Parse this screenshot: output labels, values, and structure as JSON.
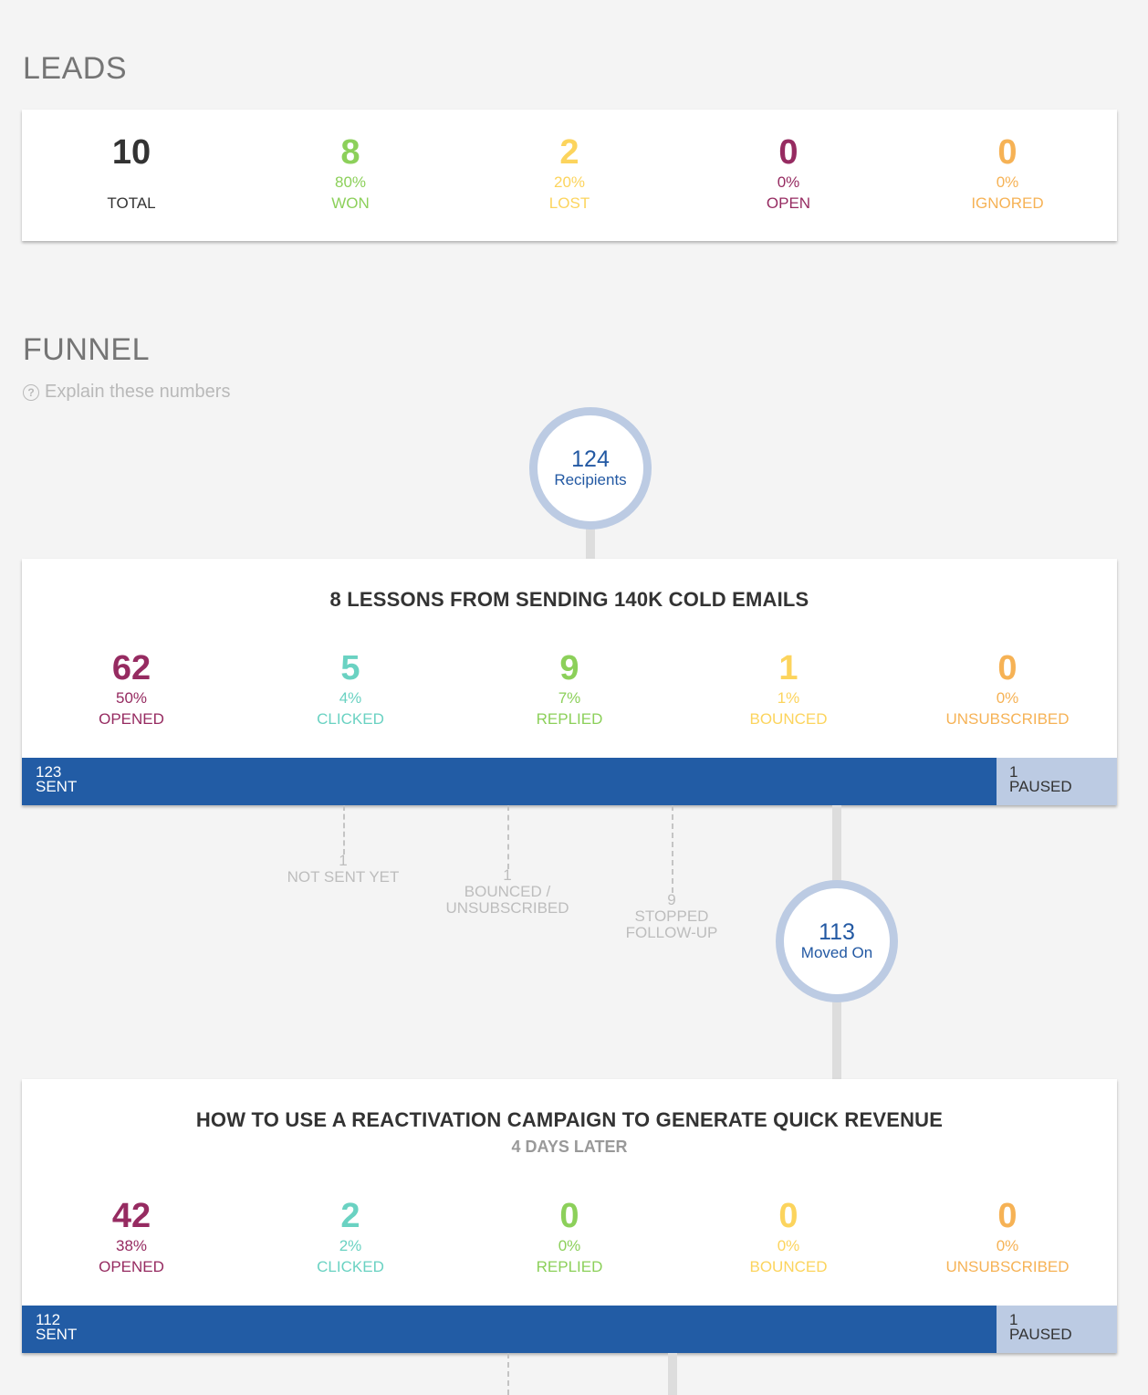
{
  "leads": {
    "title": "LEADS",
    "stats": [
      {
        "value": "10",
        "pct": "",
        "label": "TOTAL"
      },
      {
        "value": "8",
        "pct": "80%",
        "label": "WON"
      },
      {
        "value": "2",
        "pct": "20%",
        "label": "LOST"
      },
      {
        "value": "0",
        "pct": "0%",
        "label": "OPEN"
      },
      {
        "value": "0",
        "pct": "0%",
        "label": "IGNORED"
      }
    ]
  },
  "funnel": {
    "title": "FUNNEL",
    "explain_label": "Explain these numbers",
    "explain_icon": "?",
    "recipients": {
      "value": "124",
      "label": "Recipients"
    },
    "steps": [
      {
        "title": "8 LESSONS FROM SENDING 140K COLD EMAILS",
        "subtitle": "",
        "stats": [
          {
            "value": "62",
            "pct": "50%",
            "label": "OPENED"
          },
          {
            "value": "5",
            "pct": "4%",
            "label": "CLICKED"
          },
          {
            "value": "9",
            "pct": "7%",
            "label": "REPLIED"
          },
          {
            "value": "1",
            "pct": "1%",
            "label": "BOUNCED"
          },
          {
            "value": "0",
            "pct": "0%",
            "label": "UNSUBSCRIBED"
          }
        ],
        "sent": {
          "value": "123",
          "label": "SENT"
        },
        "paused": {
          "value": "1",
          "label": "PAUSED"
        },
        "sent_fraction": 0.89
      },
      {
        "title": "HOW TO USE A REACTIVATION CAMPAIGN TO GENERATE QUICK REVENUE",
        "subtitle": "4 DAYS LATER",
        "stats": [
          {
            "value": "42",
            "pct": "38%",
            "label": "OPENED"
          },
          {
            "value": "2",
            "pct": "2%",
            "label": "CLICKED"
          },
          {
            "value": "0",
            "pct": "0%",
            "label": "REPLIED"
          },
          {
            "value": "0",
            "pct": "0%",
            "label": "BOUNCED"
          },
          {
            "value": "0",
            "pct": "0%",
            "label": "UNSUBSCRIBED"
          }
        ],
        "sent": {
          "value": "112",
          "label": "SENT"
        },
        "paused": {
          "value": "1",
          "label": "PAUSED"
        },
        "sent_fraction": 0.89
      }
    ],
    "dropoffs": [
      {
        "value": "1",
        "label": "NOT SENT YET"
      },
      {
        "value": "1",
        "label": "BOUNCED / UNSUBSCRIBED"
      },
      {
        "value": "9",
        "label": "STOPPED FOLLOW-UP"
      }
    ],
    "moved_on": {
      "value": "113",
      "label": "Moved On"
    }
  },
  "colors": {
    "total": "#333333",
    "won": "#8cd05a",
    "lost": "#fcd45d",
    "open": "#962b61",
    "ignored": "#f6b255",
    "opened": "#962b61",
    "clicked": "#6ad2c2",
    "replied": "#8cd05a",
    "bounced": "#fcd45d",
    "unsubscribed": "#f6b255",
    "sent_bar": "#225ca5",
    "paused_bar": "#bccbe3"
  }
}
